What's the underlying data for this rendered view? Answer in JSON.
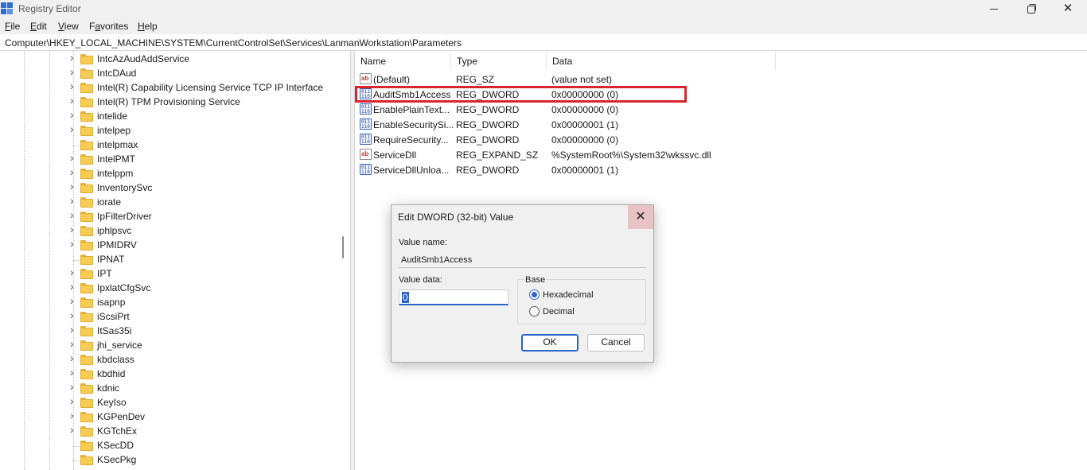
{
  "window": {
    "title": "Registry Editor"
  },
  "menu": [
    {
      "label": "File",
      "key": "F",
      "rest": "ile"
    },
    {
      "label": "Edit",
      "key": "E",
      "rest": "dit"
    },
    {
      "label": "View",
      "key": "V",
      "rest": "iew"
    },
    {
      "label": "Favorites",
      "key": "a",
      "pre": "F",
      "rest": "vorites"
    },
    {
      "label": "Help",
      "key": "H",
      "rest": "elp"
    }
  ],
  "address": "Computer\\HKEY_LOCAL_MACHINE\\SYSTEM\\CurrentControlSet\\Services\\LanmanWorkstation\\Parameters",
  "tree": {
    "items": [
      {
        "label": "IntcAzAudAddService",
        "expandable": true
      },
      {
        "label": "IntcDAud",
        "expandable": true
      },
      {
        "label": "Intel(R) Capability Licensing Service TCP IP Interface",
        "expandable": true
      },
      {
        "label": "Intel(R) TPM Provisioning Service",
        "expandable": true
      },
      {
        "label": "intelide",
        "expandable": true
      },
      {
        "label": "intelpep",
        "expandable": true
      },
      {
        "label": "intelpmax",
        "expandable": false
      },
      {
        "label": "IntelPMT",
        "expandable": true
      },
      {
        "label": "intelppm",
        "expandable": true
      },
      {
        "label": "InventorySvc",
        "expandable": true
      },
      {
        "label": "iorate",
        "expandable": true
      },
      {
        "label": "IpFilterDriver",
        "expandable": true
      },
      {
        "label": "iphlpsvc",
        "expandable": true
      },
      {
        "label": "IPMIDRV",
        "expandable": true
      },
      {
        "label": "IPNAT",
        "expandable": false
      },
      {
        "label": "IPT",
        "expandable": true
      },
      {
        "label": "IpxlatCfgSvc",
        "expandable": true
      },
      {
        "label": "isapnp",
        "expandable": true
      },
      {
        "label": "iScsiPrt",
        "expandable": true
      },
      {
        "label": "ItSas35i",
        "expandable": true
      },
      {
        "label": "jhi_service",
        "expandable": true
      },
      {
        "label": "kbdclass",
        "expandable": true
      },
      {
        "label": "kbdhid",
        "expandable": true
      },
      {
        "label": "kdnic",
        "expandable": true
      },
      {
        "label": "KeyIso",
        "expandable": true
      },
      {
        "label": "KGPenDev",
        "expandable": true
      },
      {
        "label": "KGTchEx",
        "expandable": true
      },
      {
        "label": "KSecDD",
        "expandable": false
      },
      {
        "label": "KSecPkg",
        "expandable": false
      }
    ]
  },
  "list": {
    "columns": [
      "Name",
      "Type",
      "Data"
    ],
    "rows": [
      {
        "icon": "string-value-icon",
        "name": "(Default)",
        "type": "REG_SZ",
        "data": "(value not set)"
      },
      {
        "icon": "binary-value-icon",
        "name": "AuditSmb1Access",
        "type": "REG_DWORD",
        "data": "0x00000000 (0)",
        "highlighted": true
      },
      {
        "icon": "binary-value-icon",
        "name": "EnablePlainText...",
        "type": "REG_DWORD",
        "data": "0x00000000 (0)"
      },
      {
        "icon": "binary-value-icon",
        "name": "EnableSecuritySi...",
        "type": "REG_DWORD",
        "data": "0x00000001 (1)"
      },
      {
        "icon": "binary-value-icon",
        "name": "RequireSecurity...",
        "type": "REG_DWORD",
        "data": "0x00000000 (0)"
      },
      {
        "icon": "string-value-icon",
        "name": "ServiceDll",
        "type": "REG_EXPAND_SZ",
        "data": "%SystemRoot%\\System32\\wkssvc.dll"
      },
      {
        "icon": "binary-value-icon",
        "name": "ServiceDllUnloa...",
        "type": "REG_DWORD",
        "data": "0x00000001 (1)"
      }
    ],
    "highlight_color": "#d9262e"
  },
  "dialog": {
    "title": "Edit DWORD (32-bit) Value",
    "value_name_label": "Value name:",
    "value_name": "AuditSmb1Access",
    "value_data_label": "Value data:",
    "value_data": "0",
    "base_label": "Base",
    "base_options": [
      {
        "label": "Hexadecimal",
        "selected": true
      },
      {
        "label": "Decimal",
        "selected": false
      }
    ],
    "ok_label": "OK",
    "cancel_label": "Cancel"
  }
}
